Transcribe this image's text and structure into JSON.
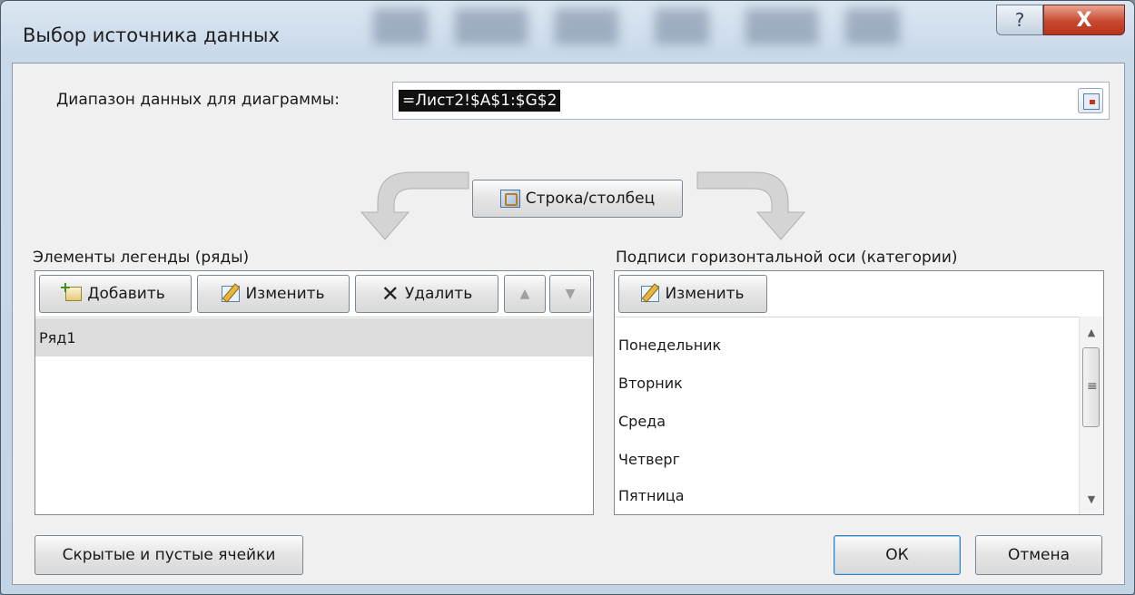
{
  "window": {
    "title": "Выбор источника данных"
  },
  "titlebar_buttons": {
    "help": "?",
    "close": "X"
  },
  "range": {
    "label": "Диапазон данных для диаграммы:",
    "value": "=Лист2!$A$1:$G$2"
  },
  "switch_button": {
    "label": "Строка/столбец"
  },
  "legend": {
    "label": "Элементы легенды (ряды)",
    "buttons": {
      "add": "Добавить",
      "edit": "Изменить",
      "delete": "Удалить"
    },
    "series": [
      "Ряд1"
    ]
  },
  "axis": {
    "label": "Подписи горизонтальной оси (категории)",
    "edit_button": "Изменить",
    "categories": [
      "Понедельник",
      "Вторник",
      "Среда",
      "Четверг",
      "Пятница"
    ]
  },
  "footer": {
    "hidden_cells": "Скрытые и пустые ячейки",
    "ok": "ОК",
    "cancel": "Отмена"
  },
  "colors": {
    "close_button": "#c8482f",
    "selection": "#dcdcdc",
    "dialog_bg": "#f0f0f0"
  }
}
